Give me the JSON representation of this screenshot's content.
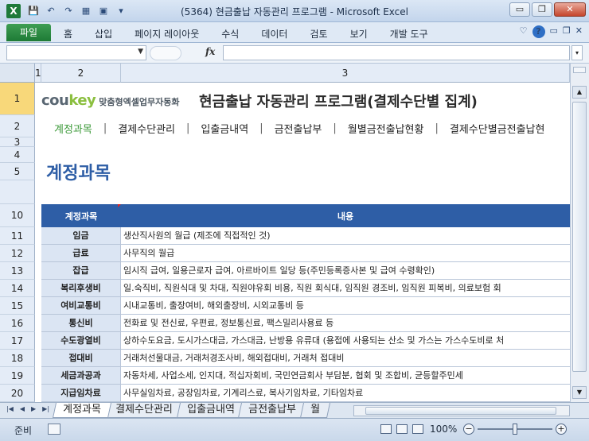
{
  "window": {
    "title": "(5364) 현금출납 자동관리 프로그램 - Microsoft Excel",
    "app_icon_letter": "X",
    "minimize": "▭",
    "restore": "❐",
    "close": "✕"
  },
  "ribbon": {
    "file_tab": "파일",
    "tabs": [
      "홈",
      "삽입",
      "페이지 레이아웃",
      "수식",
      "데이터",
      "검토",
      "보기",
      "개발 도구"
    ],
    "help": "?"
  },
  "formula_bar": {
    "fx_label": "fx",
    "name_box_value": "",
    "formula_value": ""
  },
  "grid": {
    "columns": [
      "1",
      "2",
      "3"
    ],
    "rows": [
      "1",
      "2",
      "3",
      "4",
      "5",
      "10",
      "11",
      "12",
      "13",
      "14",
      "15",
      "16",
      "17",
      "18",
      "19",
      "20"
    ]
  },
  "sheet": {
    "brand": {
      "cou": "cou",
      "key": "key",
      "sub": "맞춤형엑셀업무자동화"
    },
    "main_title": "현금출납 자동관리 프로그램(결제수단별 집계)",
    "nav": [
      "계정과목",
      "결제수단관리",
      "입출금내역",
      "금전출납부",
      "월별금전출납현황",
      "결제수단별금전출납현"
    ],
    "page_title": "계정과목",
    "table": {
      "headers": [
        "계정과목",
        "내용"
      ],
      "rows": [
        {
          "account": "임금",
          "desc": "생산직사원의 월급 (제조에 직접적인 것)"
        },
        {
          "account": "급료",
          "desc": "사무직의 월급"
        },
        {
          "account": "잡급",
          "desc": "임시직 급여, 일용근로자 급여, 아르바이트 일당 등(주민등록증사본 및 급여 수령확인)"
        },
        {
          "account": "복리후생비",
          "desc": "일.숙직비, 직원식대 및 차대, 직원야유회 비용, 직원  회식대, 임직원 경조비, 임직원 피복비, 의료보험 회"
        },
        {
          "account": "여비교통비",
          "desc": "시내교통비, 출장여비, 해외출장비, 시외교통비 등"
        },
        {
          "account": "통신비",
          "desc": "전화료 및 전신료, 우편료, 정보통신료, 팩스밀리사용료  등"
        },
        {
          "account": "수도광열비",
          "desc": "상하수도요금, 도시가스대금, 가스대금, 난방용 유류대 (용접에 사용되는 산소 및 가스는 가스수도비로 처"
        },
        {
          "account": "접대비",
          "desc": "거래처선물대금, 거래처경조사비, 해외접대비, 거래처 접대비"
        },
        {
          "account": "세금과공과",
          "desc": "자동차세, 사업소세, 인지대, 적십자회비, 국민연금회사 부담분, 협회 및 조합비, 균등할주민세"
        },
        {
          "account": "지급임차료",
          "desc": "사무실임차료, 공장임차료, 기계리스료, 복사기임차료, 기타임차료"
        }
      ]
    }
  },
  "sheet_tabs": [
    "계정과목",
    "결제수단관리",
    "입출금내역",
    "금전출납부",
    "월"
  ],
  "status": {
    "ready": "준비",
    "zoom": "100%",
    "zoom_minus": "−",
    "zoom_plus": "+"
  }
}
